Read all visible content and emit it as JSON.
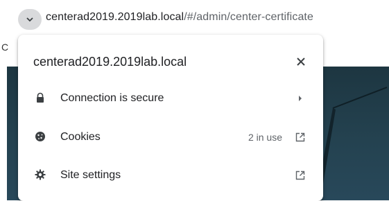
{
  "address_bar": {
    "host": "centerad2019.2019lab.local",
    "path": "/#/admin/center-certificate",
    "chip_icon": "chevron-down-icon"
  },
  "page": {
    "peek_text": "C"
  },
  "site_info_popup": {
    "title": "centerad2019.2019lab.local",
    "close_icon": "close-icon",
    "rows": [
      {
        "label": "Connection is secure",
        "icon": "lock-icon",
        "trailing_icon": "chevron-right-icon"
      },
      {
        "label": "Cookies",
        "value": "2 in use",
        "icon": "cookie-icon",
        "trailing_icon": "external-link-icon"
      },
      {
        "label": "Site settings",
        "icon": "gear-icon",
        "trailing_icon": "external-link-icon"
      }
    ]
  },
  "colors": {
    "chip_bg": "#d9dadc",
    "text_primary": "#202124",
    "text_secondary": "#5f6368",
    "page_dark": "#244250"
  }
}
